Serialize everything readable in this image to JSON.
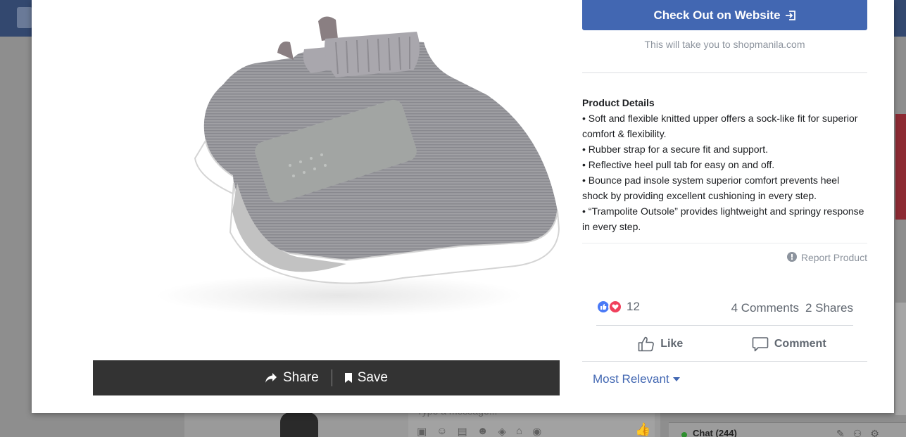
{
  "colors": {
    "brand_blue": "#4267b2",
    "share_bar": "#333333",
    "muted_text": "#8d949e",
    "like_blue": "#4a7af6",
    "love_red": "#f0405c"
  },
  "product_image": {
    "icon": "sneaker-image"
  },
  "share_bar": {
    "share_label": "Share",
    "save_label": "Save",
    "share_icon": "share-arrow-icon",
    "save_icon": "bookmark-icon"
  },
  "checkout": {
    "label": "Check Out on Website",
    "icon": "external-link-icon",
    "redirect_text": "This will take you to shopmanila.com"
  },
  "details": {
    "title": "Product Details",
    "bullets": [
      "• Soft and flexible knitted upper offers a sock-like fit for superior comfort & flexibility.",
      "• Rubber strap for a secure fit and  support.",
      "• Reflective heel pull tab for easy on and off.",
      "• Bounce pad insole system superior comfort prevents heel shock by providing excellent cushioning in every step.",
      "• “Trampolite Outsole” provides lightweight and springy response in every step."
    ]
  },
  "report": {
    "label": "Report Product",
    "icon": "flag-icon"
  },
  "reactions": {
    "count": "12",
    "icons": [
      "like-reaction-icon",
      "love-reaction-icon"
    ]
  },
  "engagement": {
    "comments": "4 Comments",
    "shares": "2 Shares"
  },
  "actions": {
    "like_label": "Like",
    "comment_label": "Comment"
  },
  "sort": {
    "label": "Most Relevant"
  },
  "background": {
    "composer_placeholder": "Type a message...",
    "chat_label": "Chat (244)"
  }
}
